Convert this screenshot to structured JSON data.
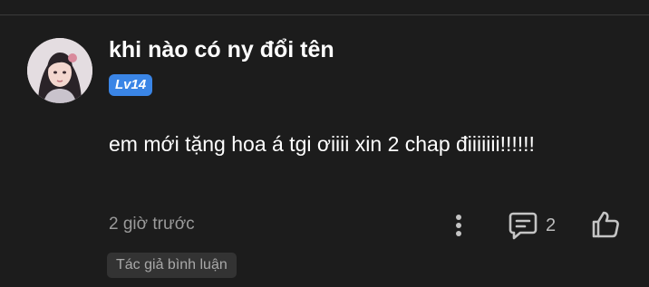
{
  "comment": {
    "username": "khi nào có ny đổi tên",
    "level_badge": "Lv14",
    "text": "em mới tặng hoa á tgi ơiiii xin 2 chap điiiiiii!!!!!!",
    "timestamp": "2 giờ trước",
    "reply_count": "2",
    "author_tag": "Tác giả bình luận"
  },
  "colors": {
    "background": "#1c1c1c",
    "level_badge": "#3a85e6",
    "muted_text": "#9a9a9a",
    "tag_background": "#333333"
  },
  "icons": {
    "more": "more-vertical-icon",
    "reply": "comment-bubble-icon",
    "like": "thumbs-up-icon"
  }
}
